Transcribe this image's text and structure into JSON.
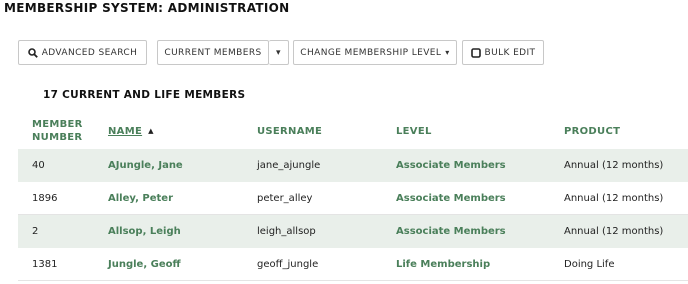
{
  "page": {
    "title": "MEMBERSHIP SYSTEM: ADMINISTRATION"
  },
  "toolbar": {
    "advanced_search": "ADVANCED SEARCH",
    "current_members": "CURRENT MEMBERS",
    "change_level": "CHANGE MEMBERSHIP LEVEL",
    "bulk_edit": "BULK EDIT"
  },
  "summary": {
    "count_label": "17 CURRENT AND LIFE MEMBERS"
  },
  "table": {
    "headers": {
      "member_number_line1": "MEMBER",
      "member_number_line2": "NUMBER",
      "name": "NAME",
      "username": "USERNAME",
      "level": "LEVEL",
      "product": "PRODUCT"
    },
    "sort": {
      "column": "name",
      "direction": "asc"
    },
    "rows": [
      {
        "number": "40",
        "name": "AJungle, Jane",
        "username": "jane_ajungle",
        "level": "Associate Members",
        "product": "Annual (12 months)"
      },
      {
        "number": "1896",
        "name": "Alley, Peter",
        "username": "peter_alley",
        "level": "Associate Members",
        "product": "Annual (12 months)"
      },
      {
        "number": "2",
        "name": "Allsop, Leigh",
        "username": "leigh_allsop",
        "level": "Associate Members",
        "product": "Annual (12 months)"
      },
      {
        "number": "1381",
        "name": "Jungle, Geoff",
        "username": "geoff_jungle",
        "level": "Life Membership",
        "product": "Doing Life"
      }
    ]
  },
  "colors": {
    "accent_green": "#4a7f5a",
    "row_alt_bg": "#e9efea",
    "border": "#c8c8c8"
  }
}
